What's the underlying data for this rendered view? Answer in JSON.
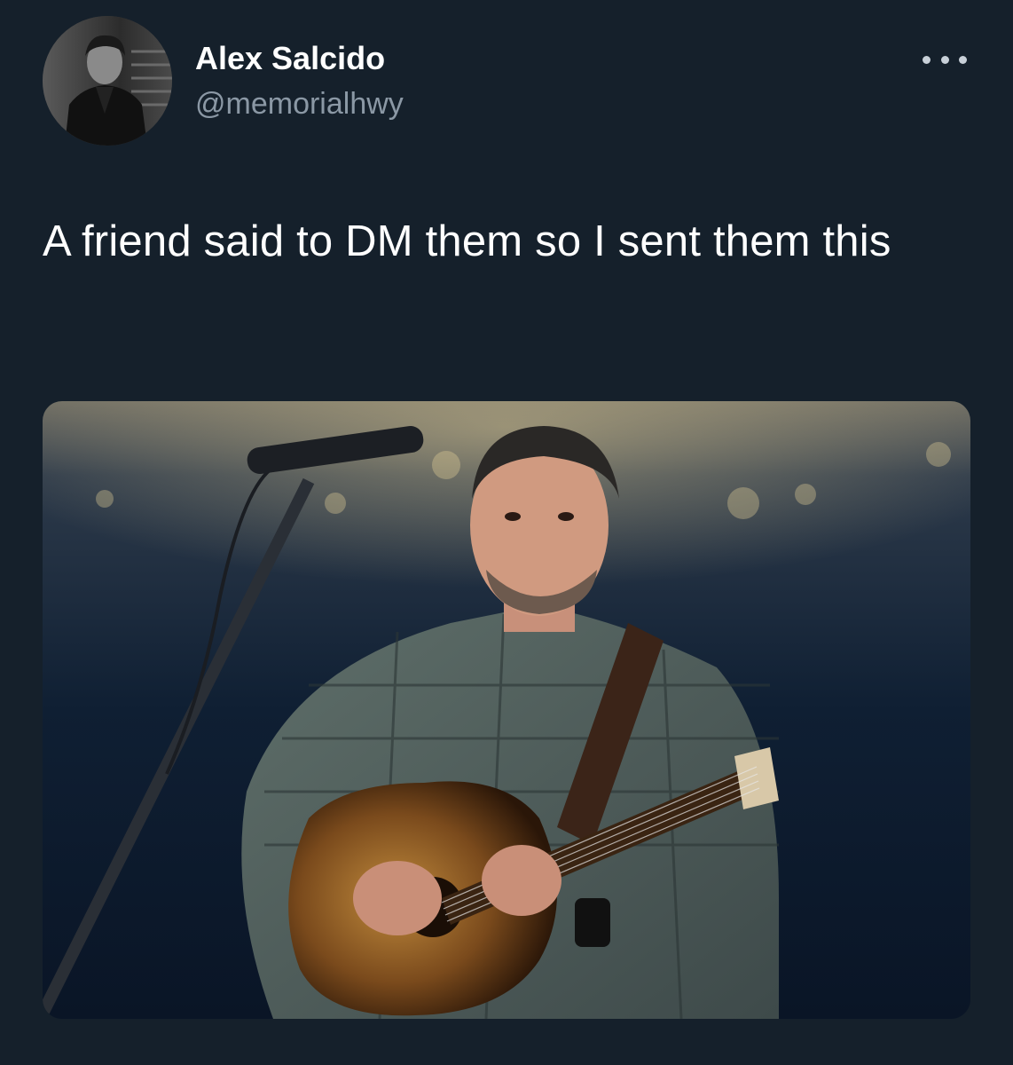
{
  "tweet": {
    "author": {
      "name": "Alex Salcido",
      "handle": "@memorialhwy",
      "avatar_icon": "profile-photo"
    },
    "more_icon": "more-options-icon",
    "text": "A friend said to DM them so I sent them this",
    "media": {
      "type": "photo",
      "description_icon": "photo-musician-with-guitar"
    }
  },
  "colors": {
    "background": "#15202b",
    "name": "#ffffff",
    "handle": "#8b98a5",
    "text": "#ffffff"
  }
}
